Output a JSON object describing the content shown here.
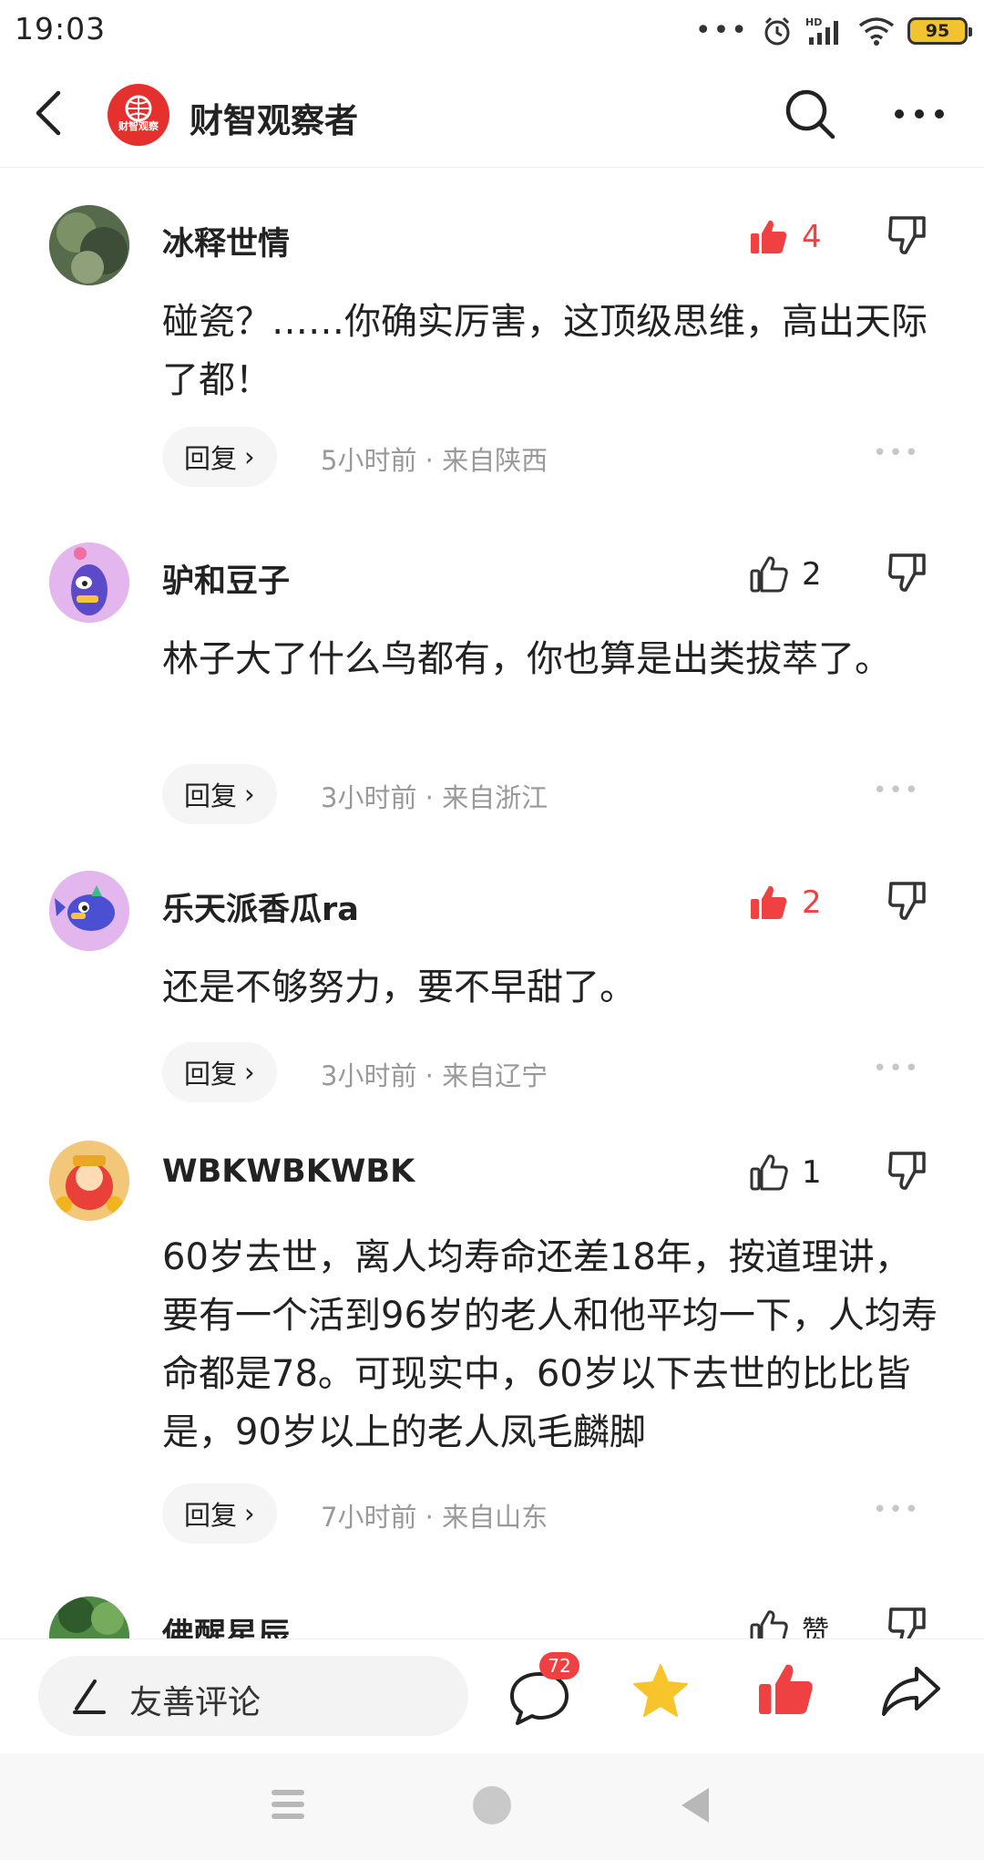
{
  "status_bar": {
    "time": "19:03",
    "battery": "95",
    "icons": [
      "more-dots-icon",
      "alarm-icon",
      "signal-hd-icon",
      "wifi-icon",
      "battery-icon"
    ]
  },
  "header": {
    "title": "财智观察者",
    "logo_text": "财智观察",
    "brand_color": "#e5312e"
  },
  "comments": [
    {
      "user": "冰释世情",
      "likes": "4",
      "liked": true,
      "text": "碰瓷？……你确实厉害，这顶级思维，高出天际了都！",
      "reply_label": "回复",
      "meta": "5小时前 · 来自陕西"
    },
    {
      "user": "驴和豆子",
      "likes": "2",
      "liked": false,
      "text": "林子大了什么鸟都有，你也算是出类拔萃了。",
      "reply_label": "回复",
      "meta": "3小时前 · 来自浙江"
    },
    {
      "user": "乐天派香瓜ra",
      "likes": "2",
      "liked": true,
      "text": "还是不够努力，要不早甜了。",
      "reply_label": "回复",
      "meta": "3小时前 · 来自辽宁"
    },
    {
      "user": "WBKWBKWBK",
      "likes": "1",
      "liked": false,
      "text": "60岁去世，离人均寿命还差18年，按道理讲，要有一个活到96岁的老人和他平均一下，人均寿命都是78。可现实中，60岁以下去世的比比皆是，90岁以上的老人凤毛麟脚",
      "reply_label": "回复",
      "meta": "7小时前 · 来自山东"
    },
    {
      "user": "佛醒星辰",
      "likes": "赞",
      "liked": false
    }
  ],
  "action_bar": {
    "input_placeholder": "友善评论",
    "comment_count": "72",
    "accent_red": "#f04142",
    "star_color": "#f7c52b"
  }
}
